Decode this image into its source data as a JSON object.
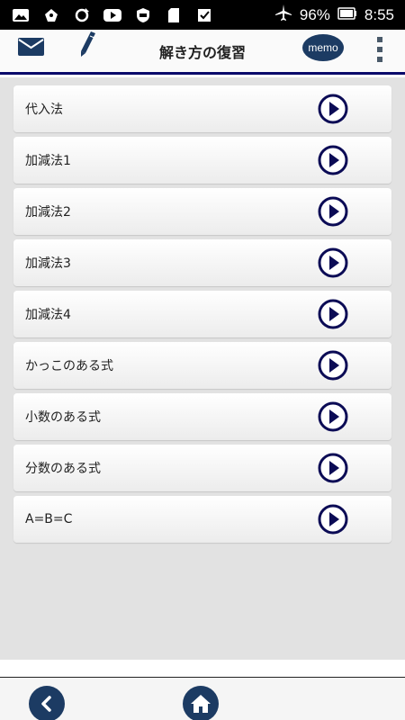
{
  "status_bar": {
    "icons": [
      "photo-icon",
      "notification-icon",
      "sync-icon",
      "youtube-icon",
      "shield-icon",
      "sd-card-icon",
      "check-icon"
    ],
    "battery": "96%",
    "time": "8:55",
    "right_icons": [
      "airplane-icon",
      "battery-icon"
    ]
  },
  "header": {
    "title": "解き方の復習",
    "memo_label": "memo",
    "left_icons": [
      "mail-icon",
      "pencil-icon"
    ],
    "right_icons": [
      "more-vert-icon"
    ],
    "accent_color": "#0a0a6a"
  },
  "list": {
    "items": [
      {
        "label": "代入法"
      },
      {
        "label": "加減法1"
      },
      {
        "label": "加減法2"
      },
      {
        "label": "加減法3"
      },
      {
        "label": "加減法4"
      },
      {
        "label": "かっこのある式"
      },
      {
        "label": "小数のある式"
      },
      {
        "label": "分数のある式"
      },
      {
        "label": "A=B=C"
      }
    ],
    "item_icon": "play-icon",
    "icon_color": "#0b0b55"
  },
  "bottom_bar": {
    "buttons": [
      "back-icon",
      "home-icon"
    ],
    "button_color": "#1c3b63"
  }
}
